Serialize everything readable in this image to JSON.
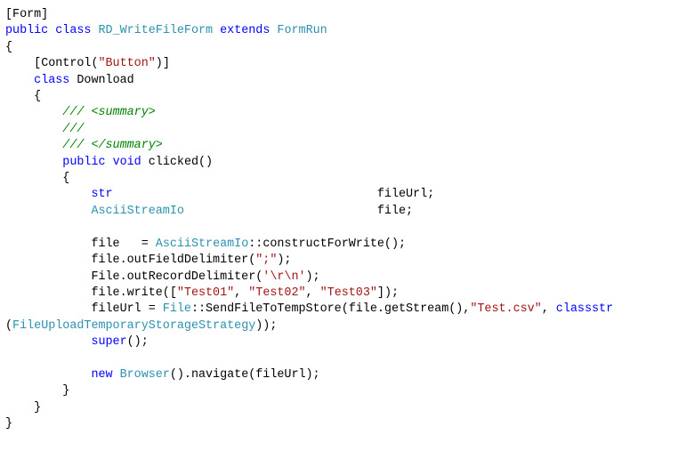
{
  "chart_data": null,
  "code": {
    "attr_form": "[Form]",
    "kw_public": "public",
    "kw_class": "class",
    "cls_name": "RD_WriteFileForm",
    "kw_extends": "extends",
    "cls_base": "FormRun",
    "attr_control_open": "[Control(",
    "attr_control_arg": "\"Button\"",
    "attr_control_close": ")]",
    "cls_download": "Download",
    "c_sum_open": "/// <summary>",
    "c_empty": "///",
    "c_sum_close": "/// </summary>",
    "kw_void": "void",
    "m_clicked": "clicked()",
    "ty_str": "str",
    "v_fileUrl": "fileUrl;",
    "ty_ascii": "AsciiStreamIo",
    "v_file": "file;",
    "a_file": "file",
    "a_eq1": "   = ",
    "m_construct": "::constructForWrite();",
    "a_outField": "file.outFieldDelimiter(",
    "s_semi": "\";\"",
    "a_close": ");",
    "a_outRecord": "File.outRecordDelimiter(",
    "s_crlf": "'\\r\\n'",
    "a_write": "file.write([",
    "s_t1": "\"Test01\"",
    "s_sep": ", ",
    "s_t2": "\"Test02\"",
    "s_t3": "\"Test03\"",
    "a_write_close": "]);",
    "a_fileUrl": "fileUrl = ",
    "ty_File": "File",
    "m_send_open": "::SendFileToTempStore(file.getStream(),",
    "s_csv": "\"Test.csv\"",
    "m_send_mid": ", ",
    "kw_classstr": "classstr",
    "p_open": "(",
    "ty_strategy": "FileUploadTemporaryStorageStrategy",
    "p_close": "));",
    "kw_super": "super",
    "a_super": "();",
    "kw_new": "new",
    "ty_browser": "Browser",
    "a_nav": "().navigate(fileUrl);"
  }
}
